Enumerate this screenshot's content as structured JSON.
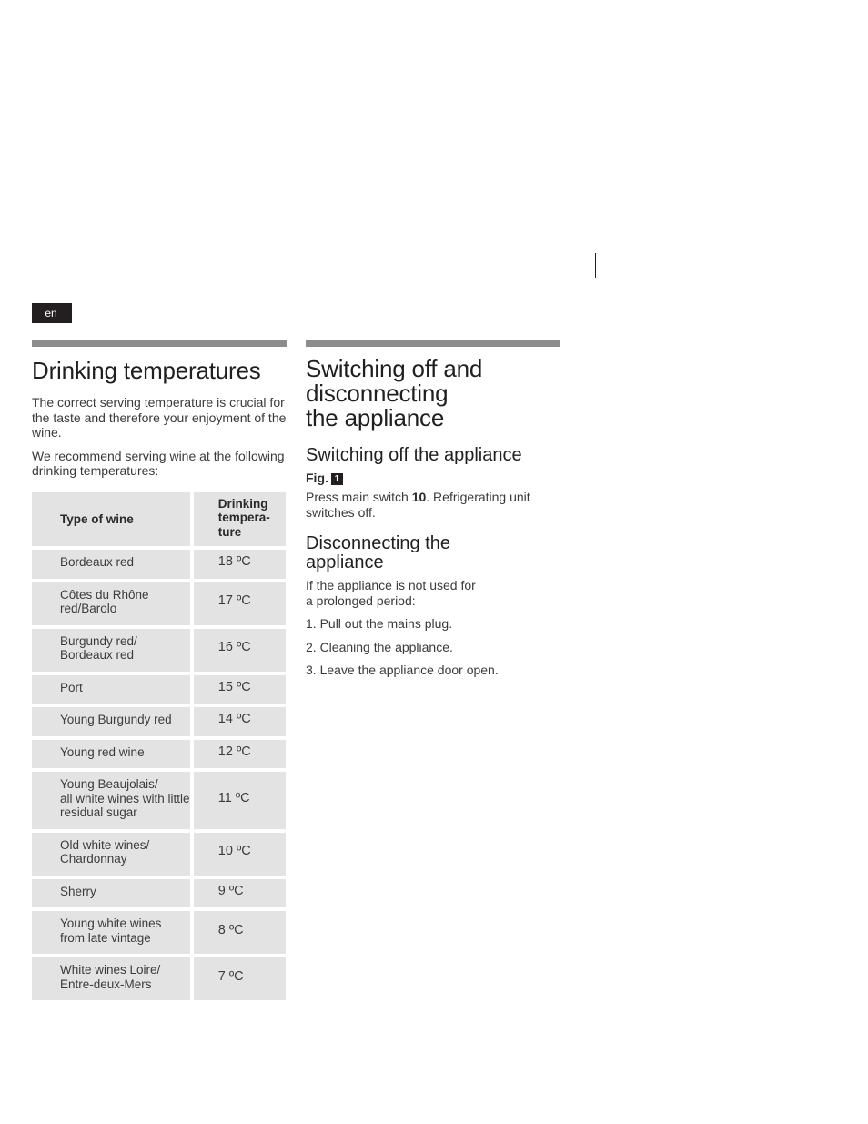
{
  "language_badge": "en",
  "left": {
    "title": "Drinking temperatures",
    "intro_1": "The correct serving temperature is crucial for the taste and therefore your enjoyment of the wine.",
    "intro_2": "We recommend serving wine at the following drinking temperatures:",
    "table": {
      "headers": [
        "Type of wine",
        "Drinking tempera-ture"
      ],
      "header_temp_lines": [
        "Drinking",
        "tempera-",
        "ture"
      ],
      "rows": [
        {
          "wine": [
            "Bordeaux red"
          ],
          "temp": "18 ºC"
        },
        {
          "wine": [
            "Côtes du Rhône",
            "red/Barolo"
          ],
          "temp": "17 ºC"
        },
        {
          "wine": [
            "Burgundy red/",
            "Bordeaux red"
          ],
          "temp": "16 ºC"
        },
        {
          "wine": [
            "Port"
          ],
          "temp": "15 ºC"
        },
        {
          "wine": [
            "Young Burgundy red"
          ],
          "temp": "14 ºC"
        },
        {
          "wine": [
            "Young red wine"
          ],
          "temp": "12 ºC"
        },
        {
          "wine": [
            "Young Beaujolais/",
            "all white wines with little",
            "residual sugar"
          ],
          "temp": "11 ºC"
        },
        {
          "wine": [
            "Old white wines/",
            "Chardonnay"
          ],
          "temp": "10 ºC"
        },
        {
          "wine": [
            "Sherry"
          ],
          "temp": "9 ºC"
        },
        {
          "wine": [
            "Young white wines",
            "from late vintage"
          ],
          "temp": "8 ºC"
        },
        {
          "wine": [
            "White wines Loire/",
            "Entre-deux-Mers"
          ],
          "temp": "7 ºC"
        }
      ]
    }
  },
  "right": {
    "title_lines": [
      "Switching off and",
      "disconnecting",
      "the appliance"
    ],
    "switch_off": {
      "heading": "Switching off the appliance",
      "fig_label": "Fig.",
      "fig_number": "1",
      "text_before": "Press main switch ",
      "switch_number": "10",
      "text_after": ". Refrigerating unit switches off."
    },
    "disconnect": {
      "heading_lines": [
        "Disconnecting the",
        "appliance"
      ],
      "intro_lines": [
        "If the appliance is not used for",
        "a prolonged  period:"
      ],
      "steps": [
        "1. Pull out the mains plug.",
        "2. Cleaning  the  appliance.",
        "3. Leave the appliance door open."
      ]
    }
  }
}
